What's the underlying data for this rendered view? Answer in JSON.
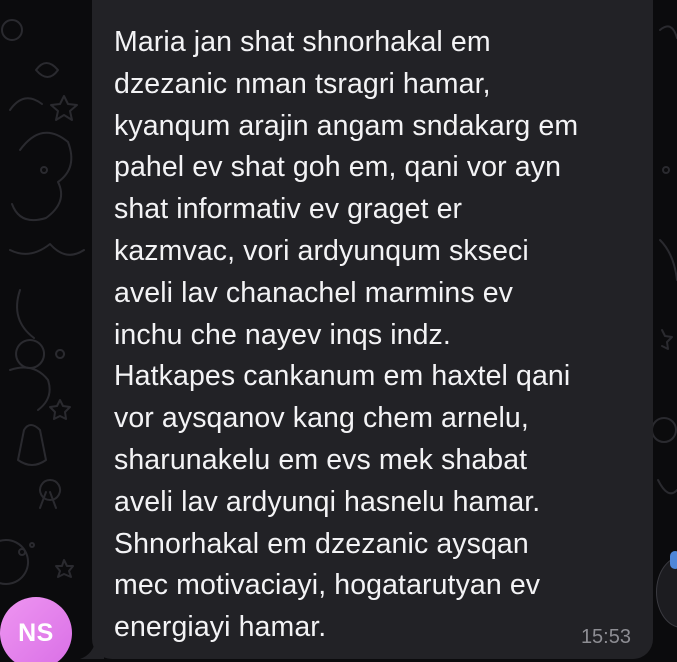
{
  "chat": {
    "message": {
      "lines": [
        "Maria jan shat shnorhakal em",
        "dzezanic nman tsragri hamar,",
        "kyanqum arajin angam sndakarg em",
        "pahel ev shat goh em, qani vor ayn",
        "shat informativ ev graget er",
        "kazmvac, vori ardyunqum skseci",
        "aveli lav chanachel marmins ev",
        "inchu che nayev inqs indz.",
        "Hatkapes cankanum em haxtel qani",
        "vor aysqanov kang chem arnelu,",
        "sharunakelu em evs mek shabat",
        "aveli lav ardyunqi hasnelu hamar.",
        "Shnorhakal em dzezanic aysqan",
        "mec motivaciayi, hogatarutyan ev",
        "energiayi hamar."
      ],
      "time": "15:53"
    },
    "sender": {
      "initials": "NS",
      "avatar_color": "#e486ee"
    },
    "colors": {
      "background": "#0b0b0d",
      "bubble": "#222226",
      "text": "#f3f3f5",
      "timestamp": "#8d8d93"
    }
  }
}
